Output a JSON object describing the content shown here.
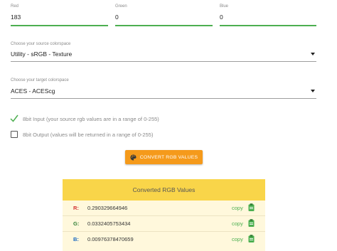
{
  "rgb_inputs": {
    "red": {
      "label": "Red",
      "value": "183"
    },
    "green": {
      "label": "Green",
      "value": "0"
    },
    "blue": {
      "label": "Blue",
      "value": "0"
    }
  },
  "source_colorspace": {
    "label": "Choose your source colorspace",
    "value": "Utility - sRGB - Texture"
  },
  "target_colorspace": {
    "label": "Choose your target colorspace",
    "value": "ACES - ACEScg"
  },
  "options": {
    "input_8bit": {
      "label": "8bit Input (your source rgb values are in a range of 0-255)",
      "checked": true
    },
    "output_8bit": {
      "label": "8bit Output (values will be returned in a range of 0-255)",
      "checked": false
    }
  },
  "convert_button": {
    "label": "CONVERT RGB VALUES",
    "icon": "palette-icon"
  },
  "results": {
    "title": "Converted RGB Values",
    "copy_label": "copy",
    "rows": [
      {
        "channel": "R:",
        "value": "0.290329664946",
        "color": "#d32f2f"
      },
      {
        "channel": "G:",
        "value": "0.0332405753434",
        "color": "#2e7d32"
      },
      {
        "channel": "B:",
        "value": "0.00976378470659",
        "color": "#1565c0"
      }
    ]
  },
  "colors": {
    "accent_green": "#4caf50",
    "button_orange": "#f59a1b",
    "results_header": "#f9d549"
  }
}
